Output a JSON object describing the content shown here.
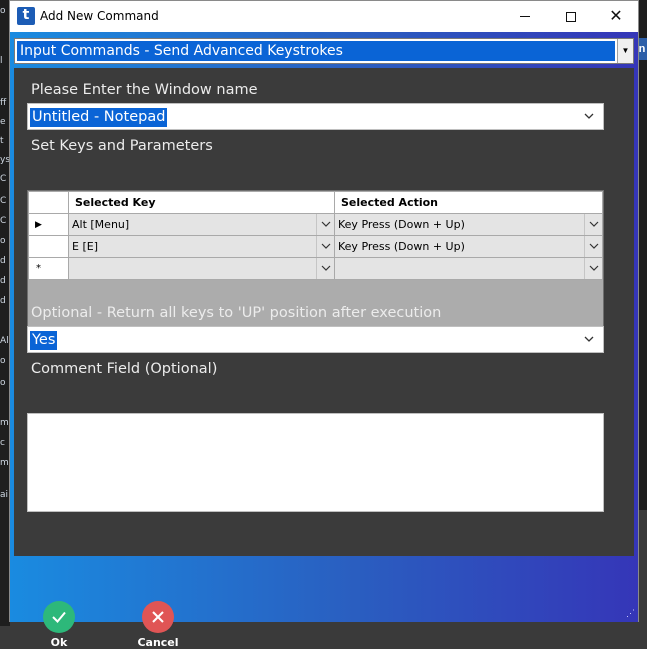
{
  "window": {
    "title": "Add New Command",
    "app_icon_letter": "t"
  },
  "command_select": {
    "value": "Input Commands - Send Advanced Keystrokes"
  },
  "form": {
    "window_name_label": "Please Enter the Window name",
    "window_name_value": "Untitled - Notepad",
    "keys_label": "Set Keys and Parameters",
    "grid": {
      "columns": [
        "Selected Key",
        "Selected Action"
      ],
      "rows": [
        {
          "marker": "▶",
          "key": "Alt [Menu]",
          "action": "Key Press (Down + Up)"
        },
        {
          "marker": "",
          "key": "E [E]",
          "action": "Key Press (Down + Up)"
        },
        {
          "marker": "*",
          "key": "",
          "action": ""
        }
      ]
    },
    "return_keys_label": "Optional - Return all keys to 'UP' position after execution",
    "return_keys_value": "Yes",
    "comment_label": "Comment Field (Optional)",
    "comment_value": ""
  },
  "footer": {
    "ok_label": "Ok",
    "cancel_label": "Cancel"
  },
  "background_app": {
    "right_tab_letter": "n",
    "left_letters": [
      "o",
      "l",
      "ff",
      "e",
      "t",
      "ys",
      "C",
      "C",
      "C",
      "o",
      "d",
      "d",
      "d",
      "Al",
      "o",
      "o",
      "m",
      "c",
      "m",
      "ai"
    ]
  },
  "colors": {
    "selection": "#0a64d6",
    "panel": "#3b3b3b",
    "ok": "#2db87a",
    "cancel": "#e05555"
  }
}
